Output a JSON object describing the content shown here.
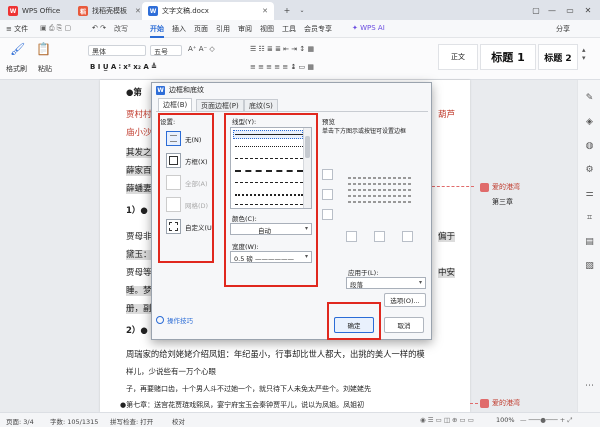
{
  "window": {
    "tabs": [
      {
        "label": "WPS Office",
        "icon": "wps-logo-icon"
      },
      {
        "label": "找稻壳模板",
        "icon": "docer-icon"
      },
      {
        "label": "文字文稿.docx",
        "icon": "word-doc-icon"
      }
    ],
    "new_tab": "+",
    "controls": [
      "▢",
      "—",
      "▭",
      "✕"
    ]
  },
  "menubar": {
    "file": "≡ 文件",
    "undo_redo": "↶ ↷",
    "more": "改写",
    "items": [
      "开始",
      "插入",
      "页面",
      "引用",
      "审阅",
      "视图",
      "工具",
      "会员专享"
    ],
    "active": "开始",
    "ai": "WPS AI",
    "share": "分享"
  },
  "ribbon": {
    "format_painter": "格式刷",
    "paste": "粘贴",
    "font_name": "黑体",
    "font_size": "五号",
    "styles": [
      {
        "label": "正文"
      },
      {
        "label": "标题 1"
      },
      {
        "label": "标题 2"
      }
    ]
  },
  "document": {
    "lines": [
      {
        "text": "●第",
        "extra": ""
      },
      {
        "text": "贾村村",
        "extra": "葫芦"
      },
      {
        "text": "庙小沙弥",
        "extra": ""
      },
      {
        "text": "其发之",
        "extra": ""
      },
      {
        "text": "薛家百",
        "extra": ""
      },
      {
        "text": "薛蟠妻",
        "extra": ""
      },
      {
        "text": "1）●",
        "extra": ""
      },
      {
        "text": "贾母非",
        "extra": "偏于"
      },
      {
        "text": "黛玉：二人",
        "extra": ""
      },
      {
        "text": "贾母等",
        "extra": "中安"
      },
      {
        "text": "睡。梦中来",
        "extra": ""
      },
      {
        "text": "册，副",
        "extra": ""
      },
      {
        "text": "2）●",
        "extra": ""
      },
      {
        "text": "周瑞家的给刘姥姥介绍凤姐：年纪虽小，行事却比世人都大，出挑的美人一样的模",
        "extra": ""
      },
      {
        "text": "样儿，少说些有一万个心眼",
        "extra": ""
      },
      {
        "text": "子，再要赌口齿，十个男人斗不过她一个，就只待下人未免太严些个。刘姥姥先",
        "extra": ""
      },
      {
        "text": "●第七章：送宫花贾琏戏熙凤，宴宁府宝玉会秦钟贾平儿，说以为凤姐。凤姐初",
        "extra": ""
      }
    ]
  },
  "comments": [
    {
      "author": "爱的港湾",
      "text": "第三章"
    },
    {
      "author": "爱的港湾",
      "text": ""
    }
  ],
  "dialog": {
    "title": "边框和底纹",
    "tabs": [
      "边框(B)",
      "页面边框(P)",
      "底纹(S)"
    ],
    "active_tab": "边框(B)",
    "settings_label": "设置:",
    "settings": [
      {
        "label": "无(N)",
        "selected": true,
        "disabled": false
      },
      {
        "label": "方框(X)",
        "selected": false,
        "disabled": false
      },
      {
        "label": "全部(A)",
        "selected": false,
        "disabled": true
      },
      {
        "label": "网格(D)",
        "selected": false,
        "disabled": true
      },
      {
        "label": "自定义(U)",
        "selected": false,
        "disabled": false
      }
    ],
    "line_style_label": "线型(Y):",
    "color_label": "颜色(C):",
    "color_value": "自动",
    "width_label": "宽度(W):",
    "width_value": "0.5  磅 ——————",
    "preview_label": "预览",
    "preview_hint": "单击下方图示或按钮可设置边框",
    "apply_label": "应用于(L):",
    "apply_value": "段落",
    "options_button": "选项(O)...",
    "tips_link": "操作技巧",
    "ok_button": "确定",
    "cancel_button": "取消"
  },
  "statusbar": {
    "page": "页面: 3/4",
    "words": "字数: 105/1315",
    "spell": "拼写检查: 打开",
    "proof": "校对",
    "zoom": "100%"
  },
  "colors": {
    "accent": "#2b6cd6",
    "highlight_box": "#e0281e",
    "comment": "#e06b6b"
  }
}
